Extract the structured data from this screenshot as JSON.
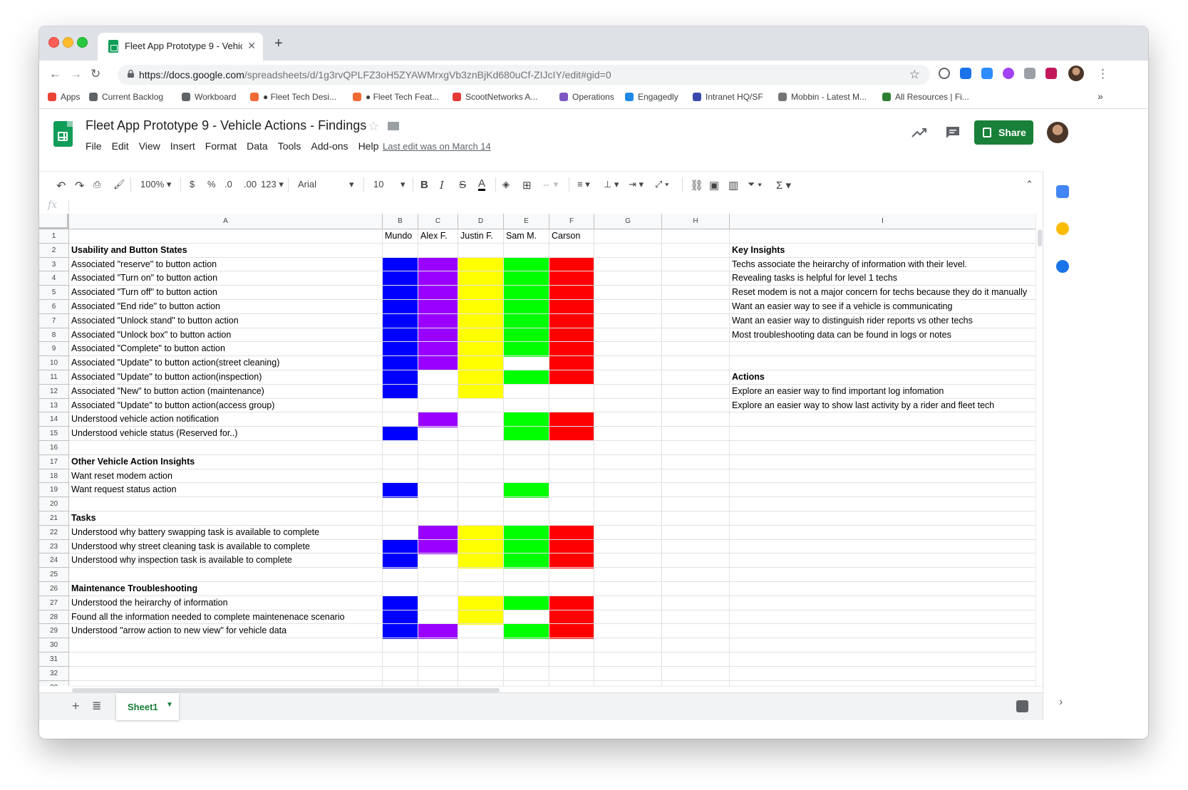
{
  "browser": {
    "tab_title": "Fleet App Prototype 9 - Vehicle Actions - Findings",
    "url_host": "https://docs.google.com",
    "url_path": "/spreadsheets/d/1g3rvQPLFZ3oH5ZYAWMrxgVb3znBjKd680uCf-ZIJcIY/edit#gid=0",
    "bookmarks": [
      {
        "label": "Apps",
        "color": "#ea4335"
      },
      {
        "label": "Current Backlog",
        "color": "#5f6368"
      },
      {
        "label": "Workboard",
        "color": "#5f6368"
      },
      {
        "label": "● Fleet Tech Desi...",
        "color": "#f06a35"
      },
      {
        "label": "● Fleet Tech Feat...",
        "color": "#f06a35"
      },
      {
        "label": "ScootNetworks A...",
        "color": "#e53935"
      },
      {
        "label": "Operations",
        "color": "#7e57c2"
      },
      {
        "label": "Engagedly",
        "color": "#1e88e5"
      },
      {
        "label": "Intranet HQ/SF",
        "color": "#3949ab"
      },
      {
        "label": "Mobbin - Latest M...",
        "color": "#757575"
      },
      {
        "label": "All Resources | Fi...",
        "color": "#2e7d32"
      }
    ],
    "more": "»"
  },
  "doc": {
    "title": "Fleet App Prototype 9 - Vehicle Actions - Findings",
    "menus": [
      "File",
      "Edit",
      "View",
      "Insert",
      "Format",
      "Data",
      "Tools",
      "Add-ons",
      "Help"
    ],
    "last_edit": "Last edit was on March 14",
    "share": "Share"
  },
  "toolbar": {
    "zoom": "100%",
    "currency": "$",
    "percent": "%",
    "dec_less": ".0",
    "dec_more": ".00",
    "format": "123",
    "font": "Arial",
    "size": "10",
    "bold": "B",
    "italic": "I",
    "strike": "S",
    "text_color": "A",
    "sum": "Σ"
  },
  "formula_bar": {
    "fx": "fx",
    "value": ""
  },
  "columns": [
    "A",
    "B",
    "C",
    "D",
    "E",
    "F",
    "G",
    "H",
    "I"
  ],
  "rows": [
    {
      "n": "1",
      "a": "",
      "b": "Mundo",
      "c": "Alex F.",
      "d": "Justin F.",
      "e": "Sam M.",
      "f": "Carson",
      "i": ""
    },
    {
      "n": "2",
      "a": "Usability and Button States",
      "bold": true,
      "i": "Key Insights",
      "ibold": true
    },
    {
      "n": "3",
      "a": "Associated \"reserve\" to button action",
      "i": "Techs associate the heirarchy of information with their level."
    },
    {
      "n": "4",
      "a": "Associated \"Turn on\" to button action",
      "i": "Revealing tasks is helpful for level 1 techs"
    },
    {
      "n": "5",
      "a": "Associated \"Turn off\" to button action",
      "i": "Reset modem is not a major concern for techs because they do it manually"
    },
    {
      "n": "6",
      "a": "Associated \"End ride\" to button action",
      "i": "Want an easier way to see if a vehicle is communicating"
    },
    {
      "n": "7",
      "a": "Associated \"Unlock stand\" to button action",
      "i": "Want an easier way to distinguish rider reports vs other techs"
    },
    {
      "n": "8",
      "a": "Associated \"Unlock box\" to button action",
      "i": "Most troubleshooting data can be found in logs or notes"
    },
    {
      "n": "9",
      "a": "Associated \"Complete\" to button action",
      "i": ""
    },
    {
      "n": "10",
      "a": "Associated \"Update\" to button action(street cleaning)",
      "i": ""
    },
    {
      "n": "11",
      "a": "Associated \"Update\" to button action(inspection)",
      "i": "Actions",
      "ibold": true
    },
    {
      "n": "12",
      "a": "Associated \"New\" to button action (maintenance)",
      "i": "Explore an easier way to find important log infomation"
    },
    {
      "n": "13",
      "a": "Associated \"Update\" to button action(access group)",
      "i": "Explore an easier way to show last activity by a rider and fleet tech"
    },
    {
      "n": "14",
      "a": "Understood vehicle action notification",
      "i": ""
    },
    {
      "n": "15",
      "a": "Understood vehicle status (Reserved for..)",
      "i": ""
    },
    {
      "n": "16",
      "a": "",
      "i": ""
    },
    {
      "n": "17",
      "a": "Other Vehicle Action Insights",
      "bold": true,
      "i": ""
    },
    {
      "n": "18",
      "a": "Want reset modem action",
      "i": ""
    },
    {
      "n": "19",
      "a": "Want request status action",
      "i": ""
    },
    {
      "n": "20",
      "a": "",
      "i": ""
    },
    {
      "n": "21",
      "a": "Tasks",
      "bold": true,
      "i": ""
    },
    {
      "n": "22",
      "a": "Understood why battery swapping task is available to complete",
      "i": ""
    },
    {
      "n": "23",
      "a": "Understood why street cleaning task is available to complete",
      "i": ""
    },
    {
      "n": "24",
      "a": "Understood why inspection task is available to complete",
      "i": ""
    },
    {
      "n": "25",
      "a": "",
      "i": ""
    },
    {
      "n": "26",
      "a": "Maintenance Troubleshooting",
      "bold": true,
      "i": ""
    },
    {
      "n": "27",
      "a": "Understood the heirarchy of information",
      "i": ""
    },
    {
      "n": "28",
      "a": "Found all the information needed to complete maintenenace scenario",
      "i": ""
    },
    {
      "n": "29",
      "a": "Understood \"arrow action to new view\" for vehicle data",
      "i": ""
    },
    {
      "n": "30",
      "a": "",
      "i": ""
    },
    {
      "n": "31",
      "a": "",
      "i": ""
    },
    {
      "n": "32",
      "a": "",
      "i": ""
    },
    {
      "n": "33",
      "a": "",
      "i": ""
    }
  ],
  "participant_colors": {
    "B": "#0000ff",
    "C": "#9900ff",
    "D": "#ffff00",
    "E": "#00ff00",
    "F": "#ff0000"
  },
  "filled_cells": {
    "B": [
      3,
      4,
      5,
      6,
      7,
      8,
      9,
      10,
      11,
      12,
      15,
      19,
      23,
      24,
      27,
      28,
      29
    ],
    "C": [
      3,
      4,
      5,
      6,
      7,
      8,
      9,
      10,
      14,
      22,
      23,
      29
    ],
    "D": [
      3,
      4,
      5,
      6,
      7,
      8,
      9,
      10,
      11,
      12,
      22,
      23,
      24,
      27,
      28
    ],
    "E": [
      3,
      4,
      5,
      6,
      7,
      8,
      9,
      11,
      14,
      15,
      19,
      22,
      23,
      24,
      27,
      29
    ],
    "F": [
      3,
      4,
      5,
      6,
      7,
      8,
      9,
      10,
      11,
      14,
      15,
      22,
      23,
      24,
      27,
      28,
      29
    ]
  },
  "sheet": {
    "tab": "Sheet1"
  }
}
